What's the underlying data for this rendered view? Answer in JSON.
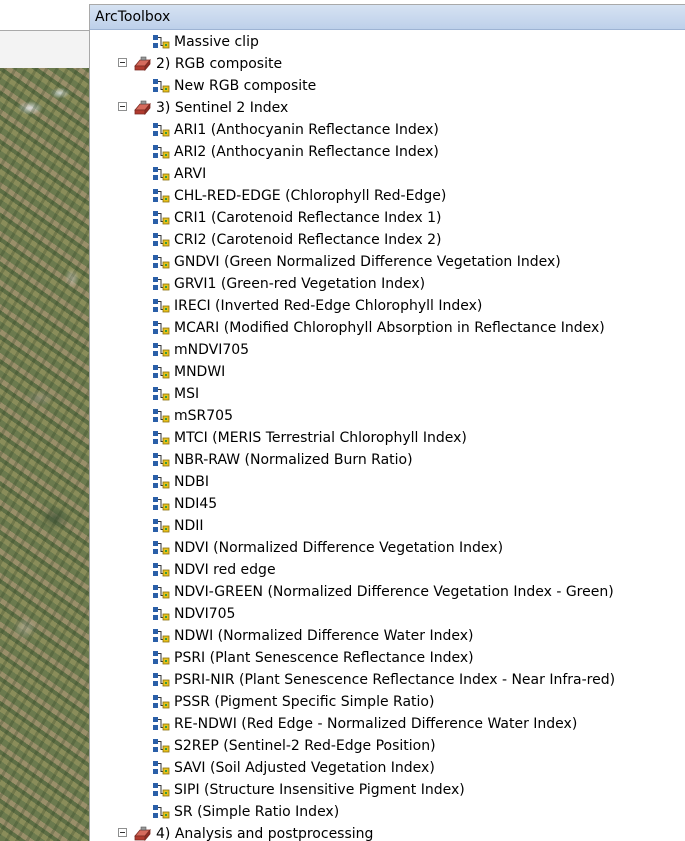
{
  "panel": {
    "title": "ArcToolbox"
  },
  "tree": {
    "rows": [
      {
        "type": "tool",
        "label": "Massive clip"
      },
      {
        "type": "toolset",
        "label": "2) RGB composite"
      },
      {
        "type": "tool",
        "label": "New RGB composite"
      },
      {
        "type": "toolset",
        "label": "3) Sentinel 2 Index"
      },
      {
        "type": "tool",
        "label": "ARI1 (Anthocyanin Reflectance Index)"
      },
      {
        "type": "tool",
        "label": "ARI2 (Anthocyanin Reflectance Index)"
      },
      {
        "type": "tool",
        "label": "ARVI"
      },
      {
        "type": "tool",
        "label": "CHL-RED-EDGE (Chlorophyll Red-Edge)"
      },
      {
        "type": "tool",
        "label": "CRI1 (Carotenoid Reflectance Index 1)"
      },
      {
        "type": "tool",
        "label": "CRI2 (Carotenoid Reflectance Index 2)"
      },
      {
        "type": "tool",
        "label": "GNDVI (Green Normalized Difference Vegetation Index)"
      },
      {
        "type": "tool",
        "label": "GRVI1 (Green-red Vegetation Index)"
      },
      {
        "type": "tool",
        "label": "IRECI (Inverted Red-Edge Chlorophyll Index)"
      },
      {
        "type": "tool",
        "label": "MCARI (Modified Chlorophyll Absorption in Reflectance Index)"
      },
      {
        "type": "tool",
        "label": "mNDVI705"
      },
      {
        "type": "tool",
        "label": "MNDWI"
      },
      {
        "type": "tool",
        "label": "MSI"
      },
      {
        "type": "tool",
        "label": "mSR705"
      },
      {
        "type": "tool",
        "label": "MTCI (MERIS Terrestrial Chlorophyll Index)"
      },
      {
        "type": "tool",
        "label": "NBR-RAW (Normalized Burn Ratio)"
      },
      {
        "type": "tool",
        "label": "NDBI"
      },
      {
        "type": "tool",
        "label": "NDI45"
      },
      {
        "type": "tool",
        "label": "NDII"
      },
      {
        "type": "tool",
        "label": "NDVI (Normalized Difference Vegetation Index)"
      },
      {
        "type": "tool",
        "label": "NDVI red edge"
      },
      {
        "type": "tool",
        "label": "NDVI-GREEN (Normalized Difference Vegetation Index - Green)"
      },
      {
        "type": "tool",
        "label": "NDVI705"
      },
      {
        "type": "tool",
        "label": "NDWI (Normalized Difference Water Index)"
      },
      {
        "type": "tool",
        "label": "PSRI (Plant Senescence Reflectance Index)"
      },
      {
        "type": "tool",
        "label": "PSRI-NIR (Plant Senescence Reflectance Index - Near Infra-red)"
      },
      {
        "type": "tool",
        "label": "PSSR (Pigment Specific Simple Ratio)"
      },
      {
        "type": "tool",
        "label": "RE-NDWI (Red Edge - Normalized Difference Water Index)"
      },
      {
        "type": "tool",
        "label": "S2REP (Sentinel-2 Red-Edge Position)"
      },
      {
        "type": "tool",
        "label": "SAVI (Soil Adjusted Vegetation Index)"
      },
      {
        "type": "tool",
        "label": "SIPI (Structure Insensitive Pigment Index)"
      },
      {
        "type": "tool",
        "label": "SR (Simple Ratio Index)"
      },
      {
        "type": "toolset",
        "label": "4) Analysis and postprocessing"
      }
    ]
  },
  "icons": {
    "tool": "model-tool-icon",
    "toolset": "toolset-icon",
    "expander": "collapse-minus-icon"
  },
  "colors": {
    "titlebar": "#c9d8ee",
    "tool_icon_blue": "#2a5fa8",
    "tool_icon_yellow": "#e8c21c",
    "tool_icon_green": "#3a9a3a",
    "toolset_red": "#b03a2e"
  }
}
